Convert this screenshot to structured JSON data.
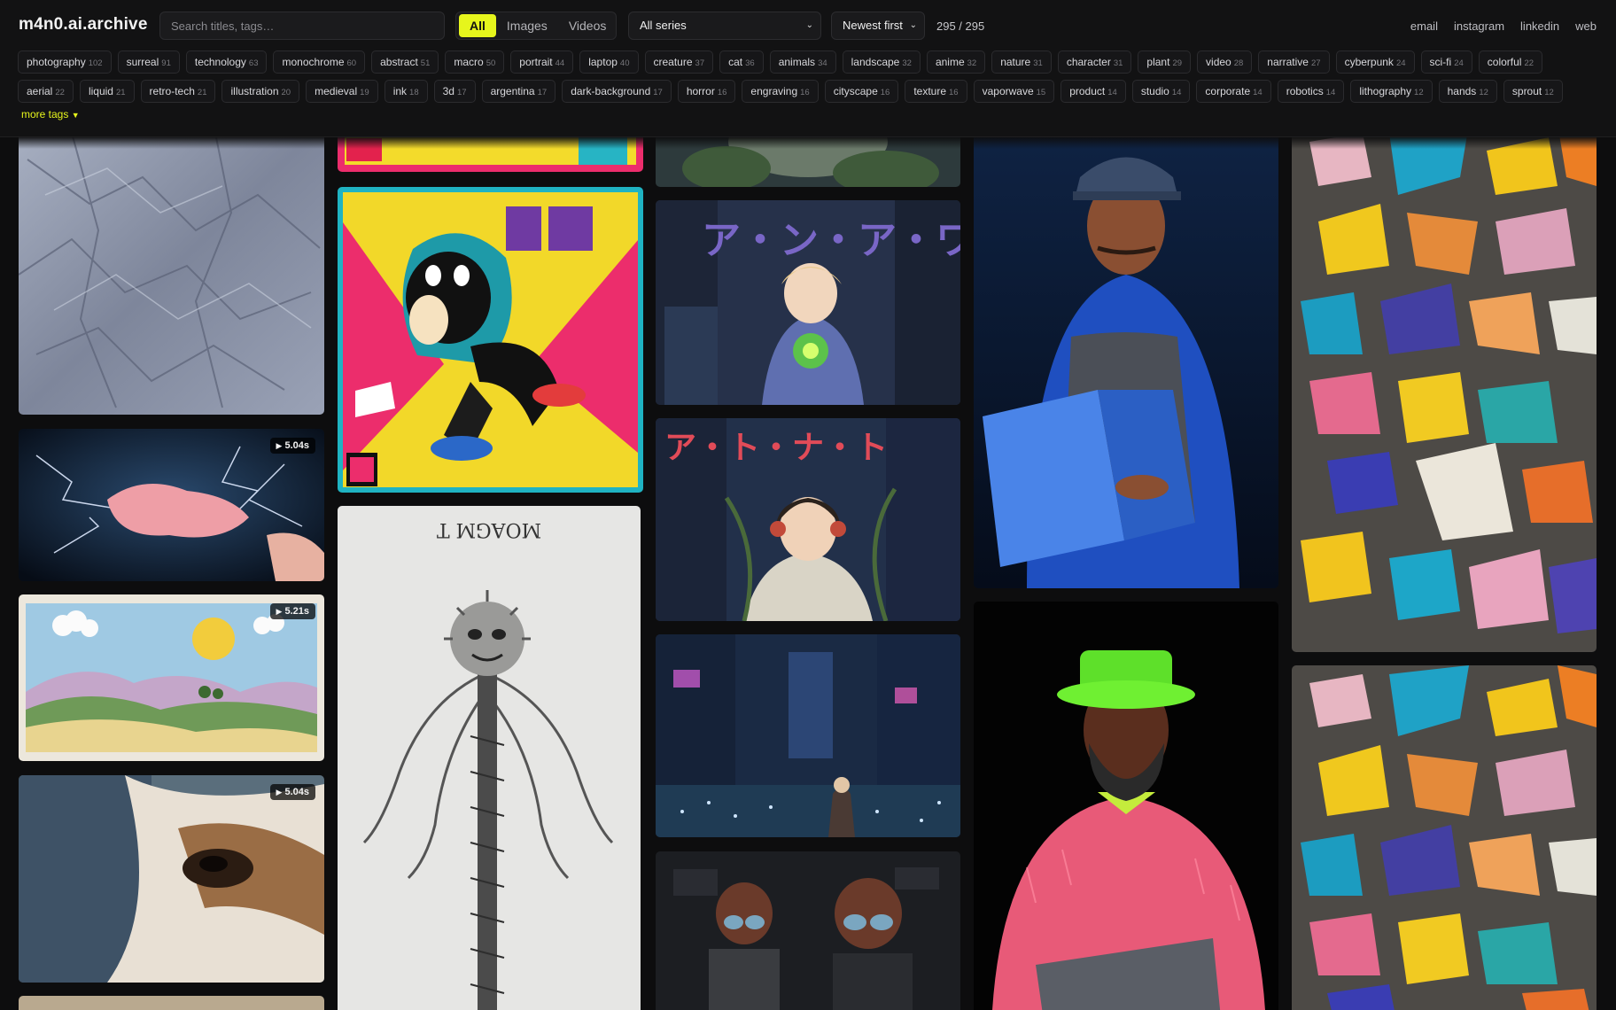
{
  "header": {
    "logo": "m4n0.ai.archive",
    "search_placeholder": "Search titles, tags…",
    "filters": [
      "All",
      "Images",
      "Videos"
    ],
    "series_select": "All series",
    "sort_select": "Newest first",
    "count": "295 / 295",
    "links": [
      "email",
      "instagram",
      "linkedin",
      "web"
    ],
    "more_tags": "more tags",
    "accent_color": "#e6f51c"
  },
  "tags_row1": [
    {
      "name": "photography",
      "count": "102"
    },
    {
      "name": "surreal",
      "count": "91"
    },
    {
      "name": "technology",
      "count": "63"
    },
    {
      "name": "monochrome",
      "count": "60"
    },
    {
      "name": "abstract",
      "count": "51"
    },
    {
      "name": "macro",
      "count": "50"
    },
    {
      "name": "portrait",
      "count": "44"
    },
    {
      "name": "laptop",
      "count": "40"
    },
    {
      "name": "creature",
      "count": "37"
    },
    {
      "name": "cat",
      "count": "36"
    },
    {
      "name": "animals",
      "count": "34"
    },
    {
      "name": "landscape",
      "count": "32"
    },
    {
      "name": "anime",
      "count": "32"
    },
    {
      "name": "nature",
      "count": "31"
    },
    {
      "name": "character",
      "count": "31"
    },
    {
      "name": "plant",
      "count": "29"
    },
    {
      "name": "video",
      "count": "28"
    },
    {
      "name": "narrative",
      "count": "27"
    },
    {
      "name": "cyberpunk",
      "count": "24"
    },
    {
      "name": "sci-fi",
      "count": "24"
    },
    {
      "name": "colorful",
      "count": "22"
    }
  ],
  "tags_row2": [
    {
      "name": "aerial",
      "count": "22"
    },
    {
      "name": "liquid",
      "count": "21"
    },
    {
      "name": "retro-tech",
      "count": "21"
    },
    {
      "name": "illustration",
      "count": "20"
    },
    {
      "name": "medieval",
      "count": "19"
    },
    {
      "name": "ink",
      "count": "18"
    },
    {
      "name": "3d",
      "count": "17"
    },
    {
      "name": "argentina",
      "count": "17"
    },
    {
      "name": "dark-background",
      "count": "17"
    },
    {
      "name": "horror",
      "count": "16"
    },
    {
      "name": "engraving",
      "count": "16"
    },
    {
      "name": "cityscape",
      "count": "16"
    },
    {
      "name": "texture",
      "count": "16"
    },
    {
      "name": "vaporwave",
      "count": "15"
    },
    {
      "name": "product",
      "count": "14"
    },
    {
      "name": "studio",
      "count": "14"
    },
    {
      "name": "corporate",
      "count": "14"
    },
    {
      "name": "robotics",
      "count": "14"
    },
    {
      "name": "lithography",
      "count": "12"
    },
    {
      "name": "hands",
      "count": "12"
    },
    {
      "name": "sprout",
      "count": "12"
    }
  ],
  "cards": [
    {
      "name": "crumpled-fabric-image",
      "type": "image",
      "subject": "crumpled gray fabric"
    },
    {
      "name": "pink-lightning-video",
      "type": "video",
      "duration": "5.04s",
      "subject": "pink blob with lightning"
    },
    {
      "name": "felt-landscape-video",
      "type": "video",
      "duration": "5.21s",
      "subject": "felt hills and sun"
    },
    {
      "name": "horse-eye-video",
      "type": "video",
      "duration": "5.04s",
      "subject": "horse eye close-up"
    },
    {
      "name": "sticker-poster-top-image",
      "type": "image",
      "subject": "colorful poster cropped"
    },
    {
      "name": "astronaut-poster-image",
      "type": "image",
      "subject": "hooded character poster"
    },
    {
      "name": "engraving-creature-image",
      "type": "image",
      "subject": "spiky creature engraving"
    },
    {
      "name": "anime-plants-top-image",
      "type": "image",
      "subject": "anime scene cropped"
    },
    {
      "name": "anime-headphones-boy-image",
      "type": "image",
      "subject": "anime boy with headphones"
    },
    {
      "name": "anime-girl-city-image",
      "type": "image",
      "subject": "anime girl in city"
    },
    {
      "name": "anime-night-city-image",
      "type": "image",
      "subject": "anime night street"
    },
    {
      "name": "anime-goggles-image",
      "type": "image",
      "subject": "anime characters with goggles"
    },
    {
      "name": "man-laptop-blue-image",
      "type": "image",
      "subject": "man with laptop in blue light"
    },
    {
      "name": "man-pink-fur-image",
      "type": "image",
      "subject": "man in pink fur with laptop"
    },
    {
      "name": "broken-shards-image-1",
      "type": "image",
      "subject": "colorful broken shards"
    },
    {
      "name": "broken-shards-image-2",
      "type": "image",
      "subject": "colorful broken shards"
    }
  ]
}
